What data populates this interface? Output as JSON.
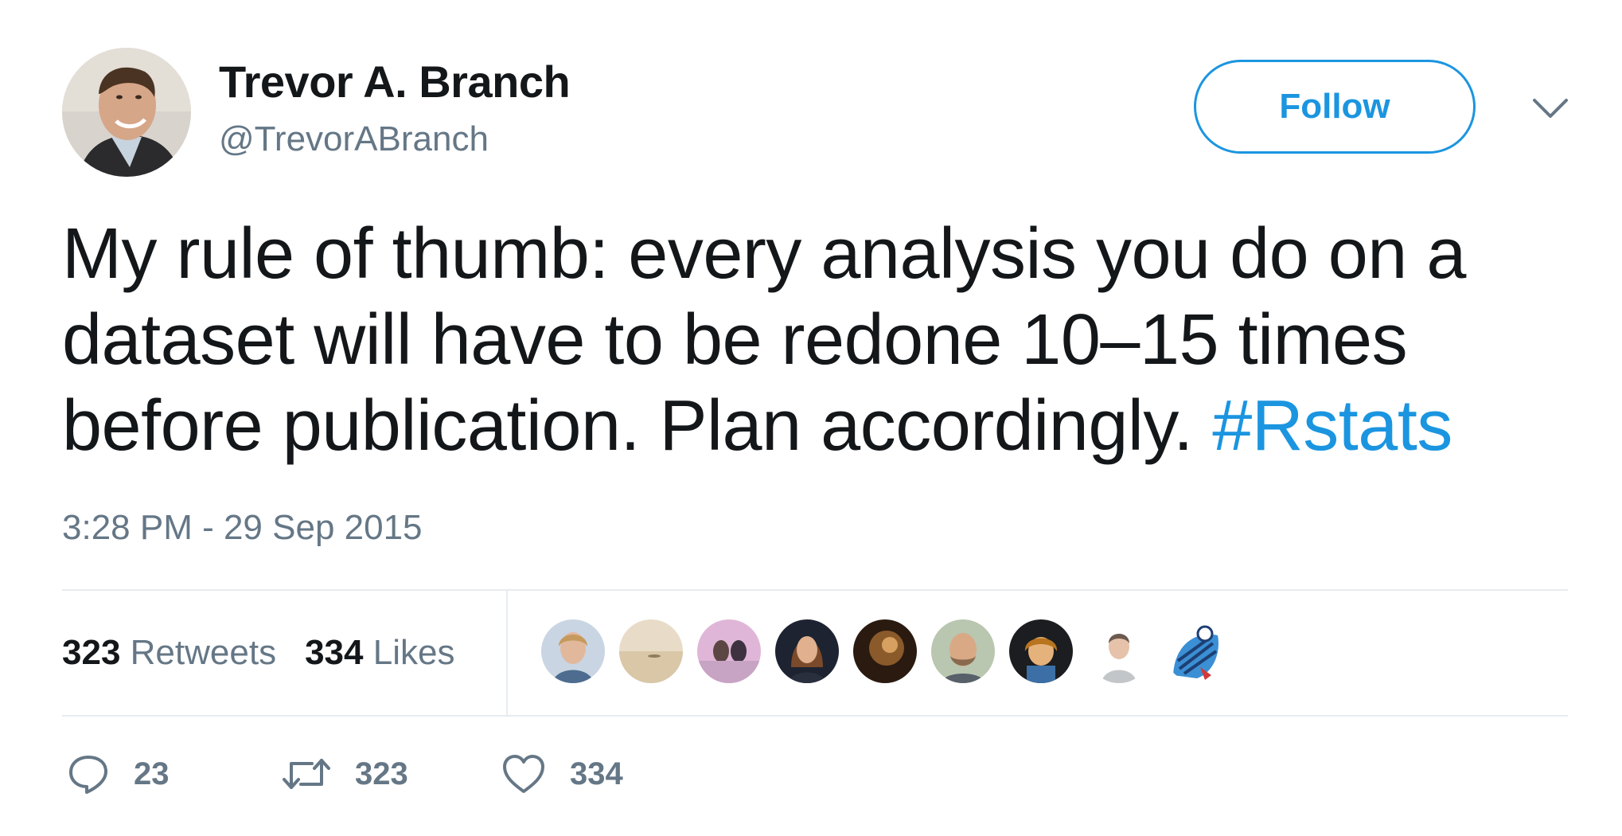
{
  "author": {
    "display_name": "Trevor A. Branch",
    "handle": "@TrevorABranch",
    "avatar_icon": "profile-photo"
  },
  "follow_button_label": "Follow",
  "tweet": {
    "lines": [
      "My rule of thumb: every analysis you do on a",
      "dataset will have to be redone 10–15 times",
      "before publication. Plan accordingly. "
    ],
    "hashtag": "#Rstats",
    "timestamp": "3:28 PM - 29 Sep 2015"
  },
  "stats": {
    "retweets_count": "323",
    "retweets_label": "Retweets",
    "likes_count": "334",
    "likes_label": "Likes"
  },
  "likers_count_shown": 9,
  "actions": {
    "reply_count": "23",
    "retweet_count": "323",
    "like_count": "334"
  },
  "colors": {
    "accent": "#1b95e0",
    "text": "#14171a",
    "muted": "#657786",
    "divider": "#e6ecf0"
  }
}
